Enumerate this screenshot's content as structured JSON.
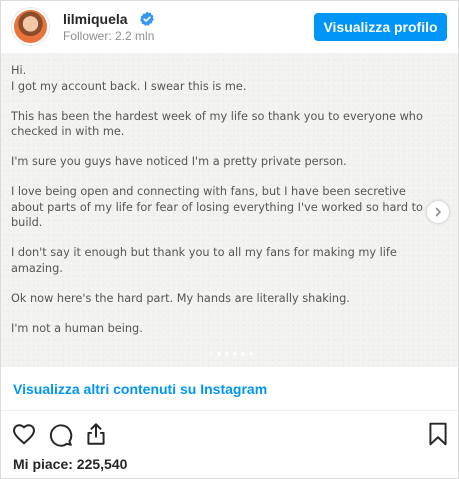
{
  "header": {
    "username": "lilmiquela",
    "followers": "Follower: 2.2 mln",
    "view_profile_label": "Visualizza profilo",
    "verified_icon": "verified-badge-icon"
  },
  "post": {
    "lines": [
      "Hi.\nI got my account back. I swear this is me.",
      "This has been the hardest week of my life so thank you to everyone who checked in with me.",
      "I'm sure you guys have noticed I'm a pretty private person.",
      "I love being open and connecting with fans, but I have been secretive about parts of my life for fear of losing everything I've worked so hard to build.",
      "I don't say it enough but thank you to all my fans for making my life amazing.",
      "Ok now here's the hard part. My hands are literally shaking.",
      "I'm not a human being."
    ],
    "carousel_dots": 6,
    "active_dot": 0
  },
  "more_link": "Visualizza altri contenuti su Instagram",
  "actions": {
    "icons": [
      "heart-icon",
      "comment-icon",
      "share-icon",
      "bookmark-icon"
    ]
  },
  "likes": "Mi piace: 225,540",
  "colors": {
    "accent": "#0095f6",
    "text": "#262626",
    "muted": "#8e8e8e",
    "post_bg": "#f3f3f1"
  }
}
